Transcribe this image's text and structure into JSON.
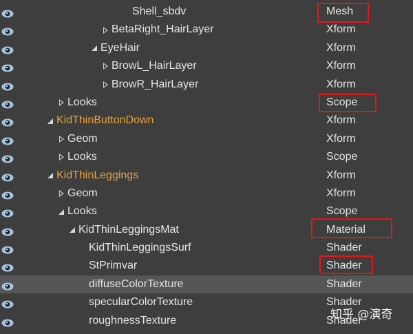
{
  "rows": [
    {
      "name": "Shell_sbdv",
      "type": "Mesh",
      "arrow": "none",
      "color": "normal"
    },
    {
      "name": "BetaRight_HairLayer",
      "type": "Xform",
      "arrow": "collapsed",
      "color": "normal"
    },
    {
      "name": "EyeHair",
      "type": "Xform",
      "arrow": "expanded",
      "color": "normal"
    },
    {
      "name": "BrowL_HairLayer",
      "type": "Xform",
      "arrow": "collapsed",
      "color": "normal"
    },
    {
      "name": "BrowR_HairLayer",
      "type": "Xform",
      "arrow": "collapsed",
      "color": "normal"
    },
    {
      "name": "Looks",
      "type": "Scope",
      "arrow": "collapsed",
      "color": "normal"
    },
    {
      "name": "KidThinButtonDown",
      "type": "Xform",
      "arrow": "expanded",
      "color": "orange"
    },
    {
      "name": "Geom",
      "type": "Xform",
      "arrow": "collapsed",
      "color": "normal"
    },
    {
      "name": "Looks",
      "type": "Scope",
      "arrow": "collapsed",
      "color": "normal"
    },
    {
      "name": "KidThinLeggings",
      "type": "Xform",
      "arrow": "expanded",
      "color": "orange"
    },
    {
      "name": "Geom",
      "type": "Xform",
      "arrow": "collapsed",
      "color": "normal"
    },
    {
      "name": "Looks",
      "type": "Scope",
      "arrow": "expanded",
      "color": "normal"
    },
    {
      "name": "KidThinLeggingsMat",
      "type": "Material",
      "arrow": "expanded",
      "color": "normal"
    },
    {
      "name": "KidThinLeggingsSurf",
      "type": "Shader",
      "arrow": "none",
      "color": "normal"
    },
    {
      "name": "StPrimvar",
      "type": "Shader",
      "arrow": "none",
      "color": "normal"
    },
    {
      "name": "diffuseColorTexture",
      "type": "Shader",
      "arrow": "none",
      "color": "normal"
    },
    {
      "name": "specularColorTexture",
      "type": "Shader",
      "arrow": "none",
      "color": "normal"
    },
    {
      "name": "roughnessTexture",
      "type": "Shader",
      "arrow": "none",
      "color": "normal"
    }
  ],
  "selected_row": 15,
  "icons": {
    "visibility": "eye-icon"
  },
  "highlight_color": "#e0181c",
  "name_color_orange": "#e8a13a",
  "watermark": "知乎 @演奇"
}
